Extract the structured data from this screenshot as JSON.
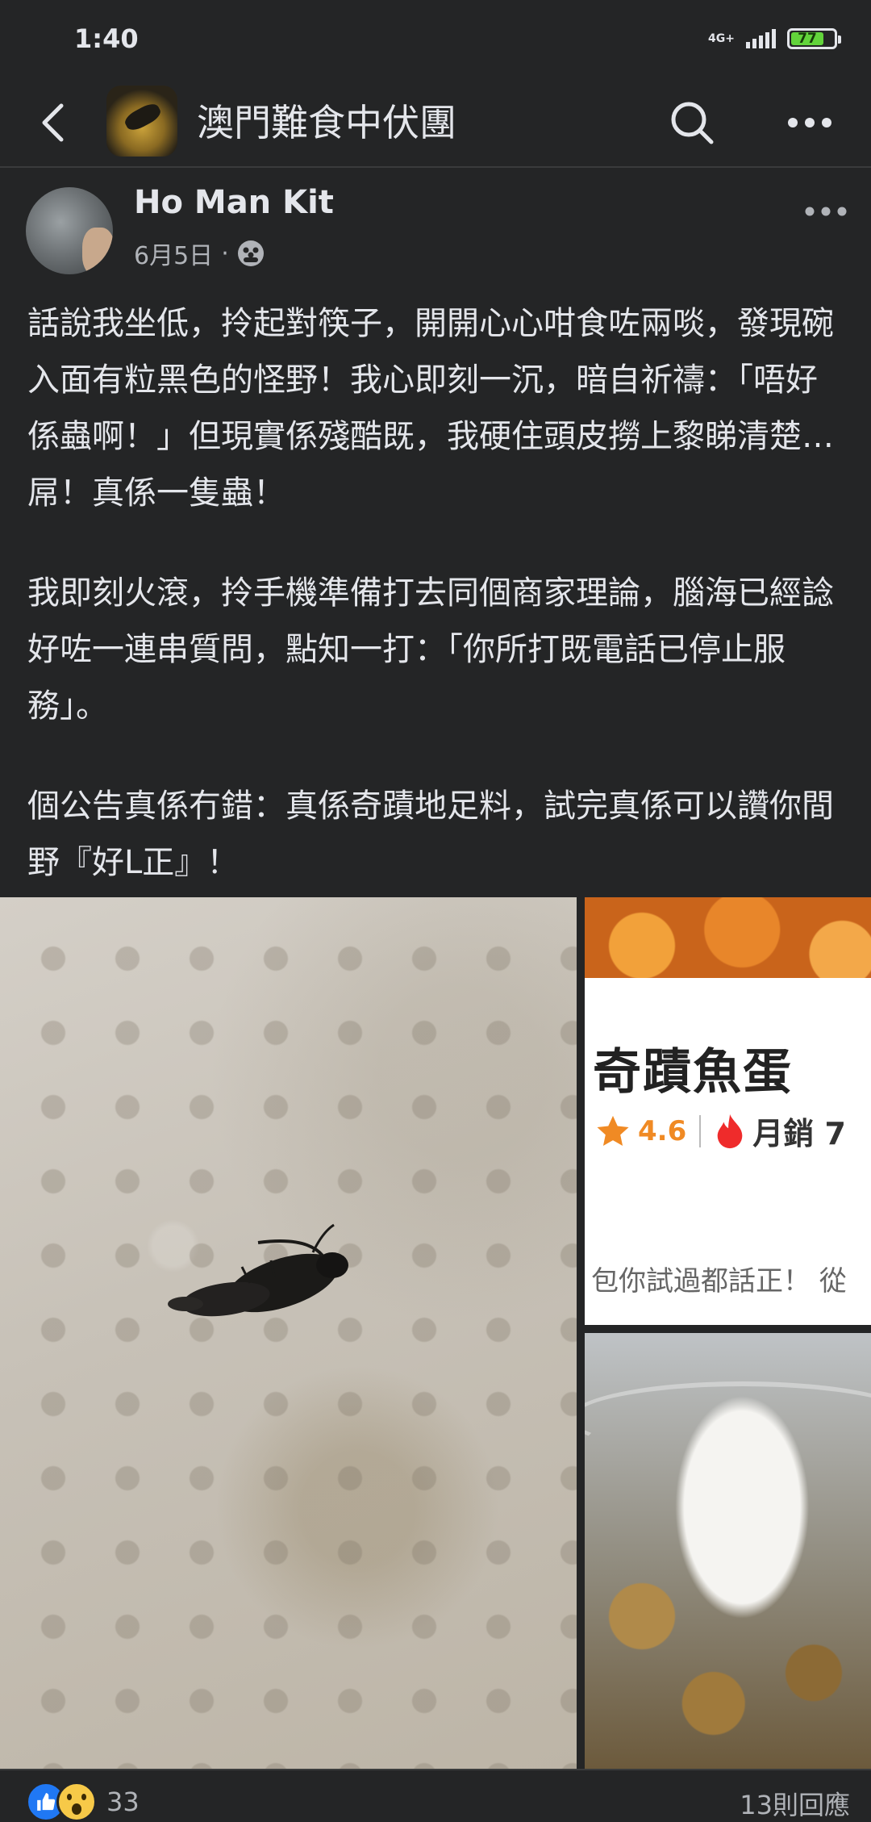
{
  "status_bar": {
    "time": "1:40",
    "network": "4G+",
    "battery": "77",
    "battery_level_percent": 77
  },
  "nav": {
    "group_name": "澳門難食中伏團",
    "icons": [
      "back-arrow-icon",
      "search-icon",
      "more-icon"
    ]
  },
  "post": {
    "author": "Ho Man Kit",
    "date": "6月5日",
    "separator": "·",
    "privacy_icon": "group-icon",
    "paragraphs": [
      "話說我坐低，拎起對筷子，開開心心咁食咗兩啖，發現碗入面有粒黑色的怪野！我心即刻一沉，暗自祈禱：「唔好係蟲啊！」但現實係殘酷既，我硬住頭皮撈上黎睇清楚…屌！真係一隻蟲！",
      "我即刻火滾，拎手機準備打去同個商家理論，腦海已經諗好咗一連串質問，點知一打：「你所打既電話已停止服務」。",
      "個公告真係冇錯：真係奇蹟地足料，試完真係可以讚你間野『好L正』！"
    ]
  },
  "media": {
    "shop_name": "奇蹟魚蛋",
    "rating": "4.6",
    "sales_label": "月銷 7",
    "slogan": "包你試過都話正！ 從"
  },
  "footer": {
    "reactions_count": "33",
    "comments": "13則回應",
    "reaction_icons": [
      "like-icon",
      "wow-icon"
    ]
  },
  "colors": {
    "background": "#242526",
    "text": "#e4e6eb",
    "secondary_text": "#b0b3b8",
    "battery": "#62d43b",
    "like": "#2078f4",
    "rating": "#f08a24"
  }
}
